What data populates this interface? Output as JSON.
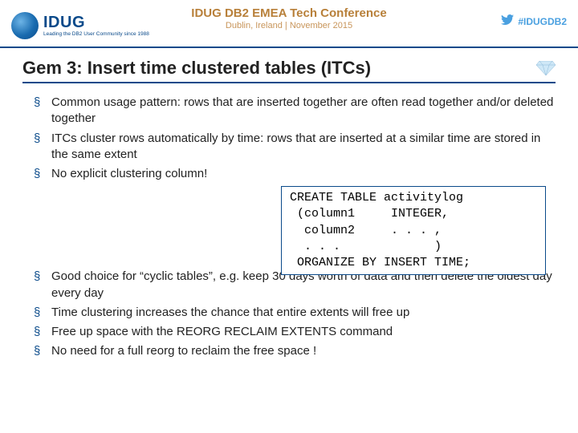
{
  "header": {
    "logo_main": "IDUG",
    "logo_tag": "Leading the DB2 User Community since 1988",
    "conf_title": "IDUG DB2 EMEA Tech Conference",
    "conf_sub": "Dublin, Ireland | November 2015",
    "hashtag": "#IDUGDB2"
  },
  "slide": {
    "title": "Gem 3: Insert time clustered tables (ITCs)"
  },
  "bullets1": {
    "b0": "Common usage pattern: rows that are inserted together are often read together and/or deleted together",
    "b1": "ITCs cluster rows automatically by time: rows that are inserted at a similar time are stored in the same extent",
    "b2": "No explicit clustering column!"
  },
  "code": "CREATE TABLE activitylog\n (column1     INTEGER,\n  column2     . . . ,\n  . . .             )\n ORGANIZE BY INSERT TIME;",
  "bullets2": {
    "b0": "Good choice for “cyclic tables”, e.g. keep 30 days worth of data and then delete the oldest day every day",
    "b1": "Time clustering increases the chance that entire extents will free up",
    "b2": "Free up space with the REORG RECLAIM EXTENTS command",
    "b3": "No need for a full reorg to reclaim the free space !"
  }
}
